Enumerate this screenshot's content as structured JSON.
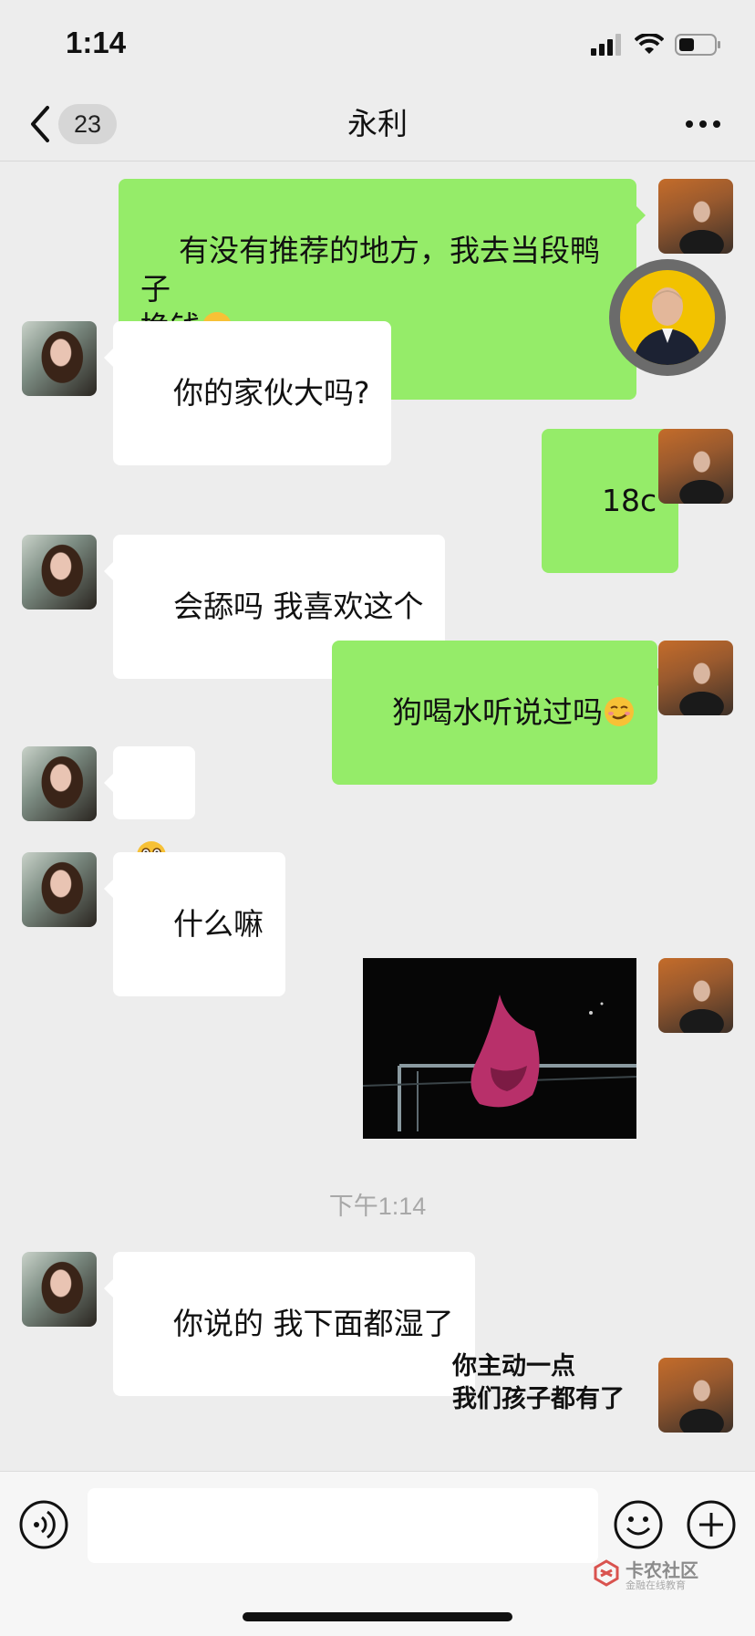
{
  "status_bar": {
    "time": "1:14"
  },
  "nav": {
    "unread_count": "23",
    "title": "永利"
  },
  "messages": {
    "m1": {
      "text": "有没有推荐的地方，我去当段鸭子\n挣钱"
    },
    "m2": {
      "text": "你的家伙大吗?"
    },
    "m3": {
      "text": "18c"
    },
    "m4": {
      "text": "会舔吗 我喜欢这个"
    },
    "m5": {
      "text": "狗喝水听说过吗"
    },
    "m7": {
      "text": "什么嘛"
    },
    "m9": {
      "text": "你说的 我下面都湿了"
    },
    "sticker": {
      "line1": "你主动一点",
      "line2": "我们孩子都有了"
    }
  },
  "timestamp": "下午1:14",
  "input": {
    "placeholder": ""
  },
  "watermark": {
    "title": "卡农社区",
    "subtitle": "金融在线教育"
  },
  "icons": [
    "signal-icon",
    "wifi-icon",
    "battery-icon",
    "back-icon",
    "more-icon",
    "voice-icon",
    "emoji-icon",
    "plus-icon"
  ],
  "colors": {
    "background": "#ededed",
    "outgoing_bubble": "#95ec69",
    "incoming_bubble": "#ffffff"
  }
}
